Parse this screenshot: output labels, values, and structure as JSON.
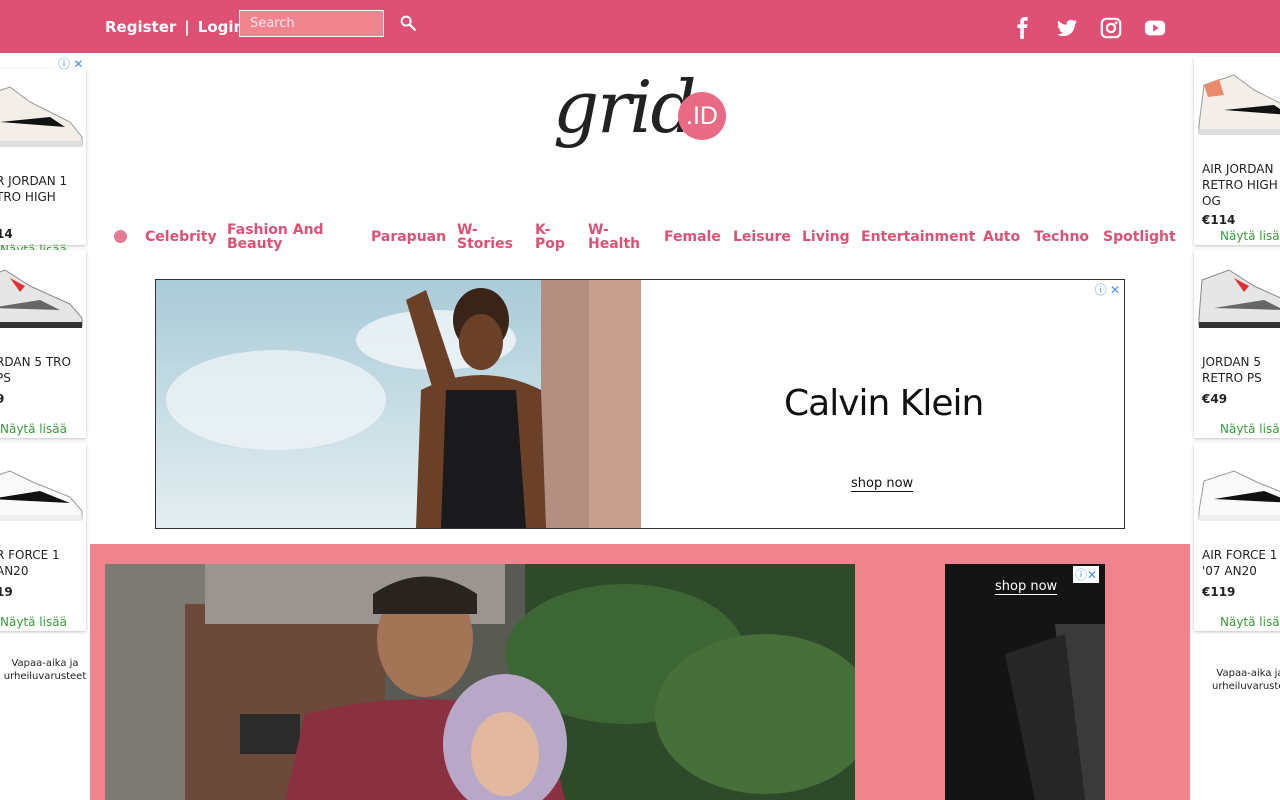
{
  "header": {
    "register": "Register",
    "separator": "|",
    "login": "Login",
    "search_placeholder": "Search",
    "social_icons": [
      "facebook-icon",
      "twitter-icon",
      "instagram-icon",
      "youtube-icon"
    ]
  },
  "logo": {
    "text": "grid",
    "badge": ".ID"
  },
  "nav": {
    "items": [
      {
        "label": "Celebrity"
      },
      {
        "label": "Fashion And Beauty"
      },
      {
        "label": "Parapuan"
      },
      {
        "label": "W-Stories"
      },
      {
        "label": "K-Pop"
      },
      {
        "label": "W-Health"
      },
      {
        "label": "Female"
      },
      {
        "label": "Leisure"
      },
      {
        "label": "Living"
      },
      {
        "label": "Entertainment"
      },
      {
        "label": "Auto"
      },
      {
        "label": "Techno"
      },
      {
        "label": "Spotlight"
      }
    ]
  },
  "left_ad": {
    "products": [
      {
        "name": "R JORDAN 1 TRO HIGH",
        "price": "14",
        "more": "Näytä lisää"
      },
      {
        "name": "RDAN 5 TRO PS",
        "price": "9",
        "more": "Näytä lisää"
      },
      {
        "name": "R FORCE 1 AN20",
        "price": "19",
        "more": "Näytä lisää"
      }
    ],
    "store": "Vapaa-aika ja urheiluvarusteet"
  },
  "right_ad": {
    "products": [
      {
        "name": "AIR JORDAN RETRO HIGH OG",
        "price": "€114",
        "more": "Näytä lisää"
      },
      {
        "name": "JORDAN 5 RETRO PS",
        "price": "€49",
        "more": "Näytä lisää"
      },
      {
        "name": "AIR FORCE 1 '07 AN20",
        "price": "€119",
        "more": "Näytä lisää"
      }
    ],
    "store": "Vapaa-aika ja urheiluvarusteet"
  },
  "banner_ad": {
    "brand": "Calvin Klein",
    "cta": "shop now"
  },
  "small_ad": {
    "cta": "shop now"
  },
  "colors": {
    "primary": "#df5174",
    "section_bg": "#ef838e",
    "link_green": "#3a9a3a"
  }
}
